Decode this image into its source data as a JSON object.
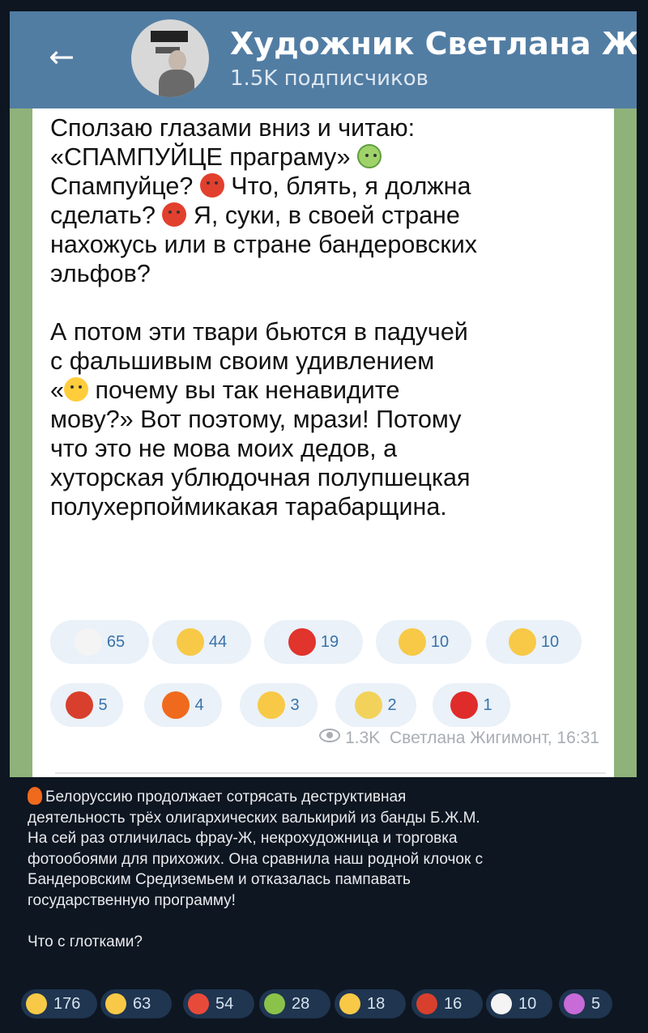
{
  "header": {
    "back_label": "←",
    "channel_name": "Художник Светлана Жиги",
    "subscribers": "1.5K подписчиков"
  },
  "screenshot_message": {
    "paragraph1": [
      "Сползаю глазами вниз и читаю:",
      "«СПАМПУЙЦЕ праграму»",
      "Спампуйце?",
      "Что, блять, я должна",
      "сделать?",
      "Я, суки, в своей стране",
      "нахожусь или в стране бандеровских",
      "эльфов?"
    ],
    "paragraph2": [
      "А потом эти твари бьются в падучей",
      "с фальшивым своим удивлением",
      "«",
      "почему вы так ненавидите",
      "мову?» Вот поэтому, мрази! Потому",
      "что это не мова моих дедов, а",
      "хуторская ублюдочная полупшецкая",
      "полухерпоймикакая тарабарщина."
    ],
    "reactions": [
      {
        "icon": "clown-face-icon",
        "count": "65",
        "color": "#f4f4f4"
      },
      {
        "icon": "clapping-hands-icon",
        "count": "44",
        "color": "#f7c947"
      },
      {
        "icon": "hundred-points-icon",
        "count": "19",
        "color": "#e0342c"
      },
      {
        "icon": "thumbs-up-icon",
        "count": "10",
        "color": "#f7c947"
      },
      {
        "icon": "thumbs-down-icon",
        "count": "10",
        "color": "#f7c947"
      },
      {
        "icon": "cursing-face-icon",
        "count": "5",
        "color": "#d8402d"
      },
      {
        "icon": "fire-icon",
        "count": "4",
        "color": "#f06a1d"
      },
      {
        "icon": "grinning-face-icon",
        "count": "3",
        "color": "#f7c947"
      },
      {
        "icon": "banana-icon",
        "count": "2",
        "color": "#f3d25c"
      },
      {
        "icon": "red-heart-icon",
        "count": "1",
        "color": "#e02b2b"
      }
    ],
    "views": "1.3K",
    "author_time": "Светлана Жигимонт, 16:31"
  },
  "post": {
    "lines": [
      "Белоруссию продолжает сотрясать деструктивная",
      "деятельность трёх олигархических валькирий из банды Б.Ж.М.",
      "На сей раз отличилась фрау-Ж, некрохудожница и торговка",
      "фотообоями для прихожих. Она сравнила наш родной клочок с",
      "Бандеровским Средиземьем и отказалась пампавать",
      "государственную программу!"
    ],
    "question": "Что с глотками?",
    "reactions": [
      {
        "icon": "screaming-face-icon",
        "count": "176",
        "color": "#f7c947"
      },
      {
        "icon": "rofl-face-icon",
        "count": "63",
        "color": "#f7c947"
      },
      {
        "icon": "pill-icon",
        "count": "54",
        "color": "#e84a3a"
      },
      {
        "icon": "vomiting-face-icon",
        "count": "28",
        "color": "#8bc34a"
      },
      {
        "icon": "exploding-head-icon",
        "count": "18",
        "color": "#f7c947"
      },
      {
        "icon": "cursing-face-icon",
        "count": "16",
        "color": "#d8402d"
      },
      {
        "icon": "clown-face-icon",
        "count": "10",
        "color": "#f4f4f4"
      },
      {
        "icon": "nail-polish-icon",
        "count": "5",
        "color": "#c86ad8"
      }
    ]
  }
}
